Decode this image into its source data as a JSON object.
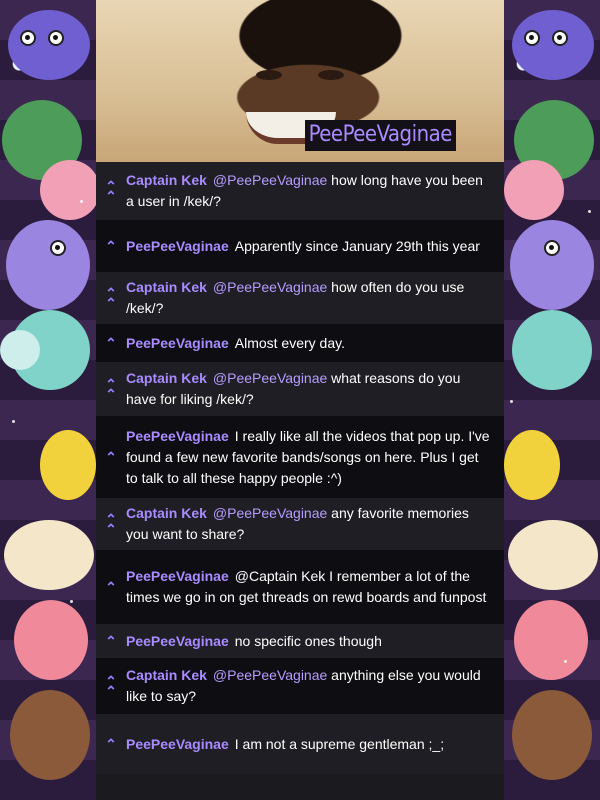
{
  "header": {
    "username_tag": "PeePeeVaginae"
  },
  "messages": [
    {
      "author": "Captain Kek",
      "mention": "@PeePeeVaginae",
      "text": " how long have you been a user in /kek/?",
      "vote": "double"
    },
    {
      "author": "PeePeeVaginae",
      "mention": "",
      "text": "Apparently since January 29th this year",
      "vote": "single"
    },
    {
      "author": "Captain Kek",
      "mention": "@PeePeeVaginae",
      "text": " how often do you use /kek/?",
      "vote": "double"
    },
    {
      "author": "PeePeeVaginae",
      "mention": "",
      "text": "Almost every day.",
      "vote": "single"
    },
    {
      "author": "Captain Kek",
      "mention": "@PeePeeVaginae",
      "text": " what reasons do you have for liking /kek/?",
      "vote": "double"
    },
    {
      "author": "PeePeeVaginae",
      "mention": "",
      "text": "I really like all the videos that pop up. I've found a few new favorite bands/songs on here. Plus I get to talk to all these happy people :^)",
      "vote": "single"
    },
    {
      "author": "Captain Kek",
      "mention": "@PeePeeVaginae",
      "text": " any favorite memories you want to share?",
      "vote": "double"
    },
    {
      "author": "PeePeeVaginae",
      "mention": "",
      "text": "@Captain Kek I remember a lot of the times we go in on get threads on rewd boards and funpost",
      "vote": "single"
    },
    {
      "author": "PeePeeVaginae",
      "mention": "",
      "text": "no specific ones though",
      "vote": "single"
    },
    {
      "author": "Captain Kek",
      "mention": "@PeePeeVaginae",
      "text": " anything else you would like to say?",
      "vote": "double"
    },
    {
      "author": "PeePeeVaginae",
      "mention": "",
      "text": "I am not a supreme gentleman ;_;",
      "vote": "single"
    }
  ],
  "icons": {
    "double": "double-chevron-up-icon",
    "single": "chevron-up-icon"
  },
  "colors": {
    "accent": "#a98bff",
    "message_bg_dark": "#0e0e12",
    "message_bg_mid": "#1e1e24",
    "side_bg": "#2a1c38"
  }
}
